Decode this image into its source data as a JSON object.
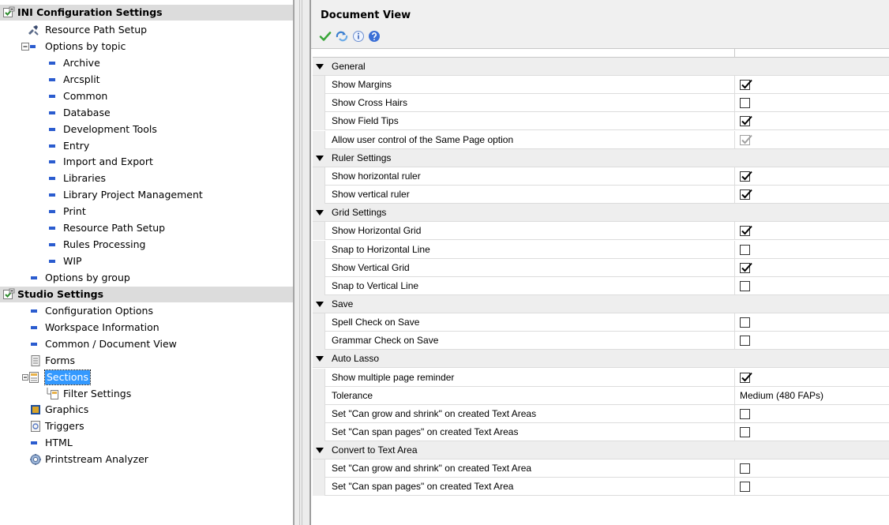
{
  "tree": {
    "ini_header": "INI Configuration Settings",
    "resource_path_setup": "Resource Path Setup",
    "options_by_topic": "Options by topic",
    "topics": [
      "Archive",
      "Arcsplit",
      "Common",
      "Database",
      "Development Tools",
      "Entry",
      "Import and Export",
      "Libraries",
      "Library Project Management",
      "Print",
      "Resource Path Setup",
      "Rules Processing",
      "WIP"
    ],
    "options_by_group": "Options by group",
    "studio_header": "Studio Settings",
    "studio_items": [
      "Configuration Options",
      "Workspace Information",
      "Common / Document View",
      "Forms",
      "Sections",
      "Filter Settings",
      "Graphics",
      "Triggers",
      "HTML",
      "Printstream Analyzer"
    ]
  },
  "panel": {
    "title": "Document View",
    "toolbar": [
      "apply-icon",
      "refresh-icon",
      "info-icon",
      "help-icon"
    ]
  },
  "grid": {
    "rows": [
      {
        "type": "cat",
        "label": "General"
      },
      {
        "type": "prop",
        "label": "Show Margins",
        "checked": true
      },
      {
        "type": "prop",
        "label": "Show Cross Hairs",
        "checked": false
      },
      {
        "type": "prop",
        "label": "Show Field Tips",
        "checked": true
      },
      {
        "type": "prop",
        "label": "Allow user control of the Same Page option",
        "checked": true,
        "disabled": true
      },
      {
        "type": "cat",
        "label": "Ruler Settings"
      },
      {
        "type": "prop",
        "label": "Show horizontal ruler",
        "checked": true
      },
      {
        "type": "prop",
        "label": "Show vertical ruler",
        "checked": true
      },
      {
        "type": "cat",
        "label": "Grid Settings"
      },
      {
        "type": "prop",
        "label": "Show Horizontal Grid",
        "checked": true
      },
      {
        "type": "prop",
        "label": "Snap to Horizontal Line",
        "checked": false
      },
      {
        "type": "prop",
        "label": "Show Vertical Grid",
        "checked": true
      },
      {
        "type": "prop",
        "label": "Snap to Vertical  Line",
        "checked": false
      },
      {
        "type": "cat",
        "label": "Save"
      },
      {
        "type": "prop",
        "label": "Spell Check on Save",
        "checked": false
      },
      {
        "type": "prop",
        "label": "Grammar Check on Save",
        "checked": false
      },
      {
        "type": "cat",
        "label": "Auto Lasso"
      },
      {
        "type": "prop",
        "label": "Show multiple page reminder",
        "checked": true
      },
      {
        "type": "prop",
        "label": "Tolerance",
        "value": "Medium (480 FAPs)"
      },
      {
        "type": "prop",
        "label": "Set \"Can grow and shrink\" on created Text Areas",
        "checked": false
      },
      {
        "type": "prop",
        "label": "Set \"Can span pages\" on created Text Areas",
        "checked": false
      },
      {
        "type": "cat",
        "label": "Convert to Text Area"
      },
      {
        "type": "prop",
        "label": "Set \"Can grow and shrink\" on created Text Area",
        "checked": false
      },
      {
        "type": "prop",
        "label": "Set \"Can span pages\" on created Text Area",
        "checked": false
      }
    ]
  }
}
